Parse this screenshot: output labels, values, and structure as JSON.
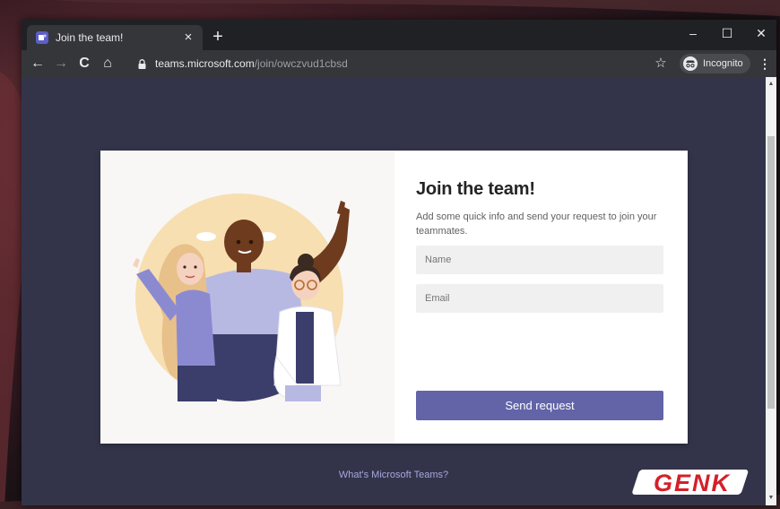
{
  "browser": {
    "tab_title": "Join the team!",
    "tab_close": "×",
    "new_tab": "+",
    "window_controls": {
      "minimize": "–",
      "maximize": "☐",
      "close": "✕"
    },
    "nav": {
      "back": "←",
      "forward": "→",
      "reload": "C",
      "home": "⌂"
    },
    "url_host": "teams.microsoft.com",
    "url_path": "/join/owczvud1cbsd",
    "star": "☆",
    "incognito_label": "Incognito",
    "menu": "⋮"
  },
  "page": {
    "title": "Join the team!",
    "subtitle": "Add some quick info and send your request to join your teammates.",
    "name_placeholder": "Name",
    "email_placeholder": "Email",
    "send_button": "Send request",
    "footer_link": "What's Microsoft Teams?"
  },
  "watermark": {
    "text": "GENK"
  },
  "colors": {
    "page_bg": "#33344a",
    "accent": "#6264a7",
    "field_bg": "#f0f0f0",
    "chrome_dark": "#202124",
    "chrome_toolbar": "#35363a"
  },
  "icons": {
    "tab_favicon": "teams-icon",
    "lock": "lock-icon",
    "star": "star-icon",
    "incognito": "incognito-icon",
    "menu": "kebab-menu-icon"
  }
}
